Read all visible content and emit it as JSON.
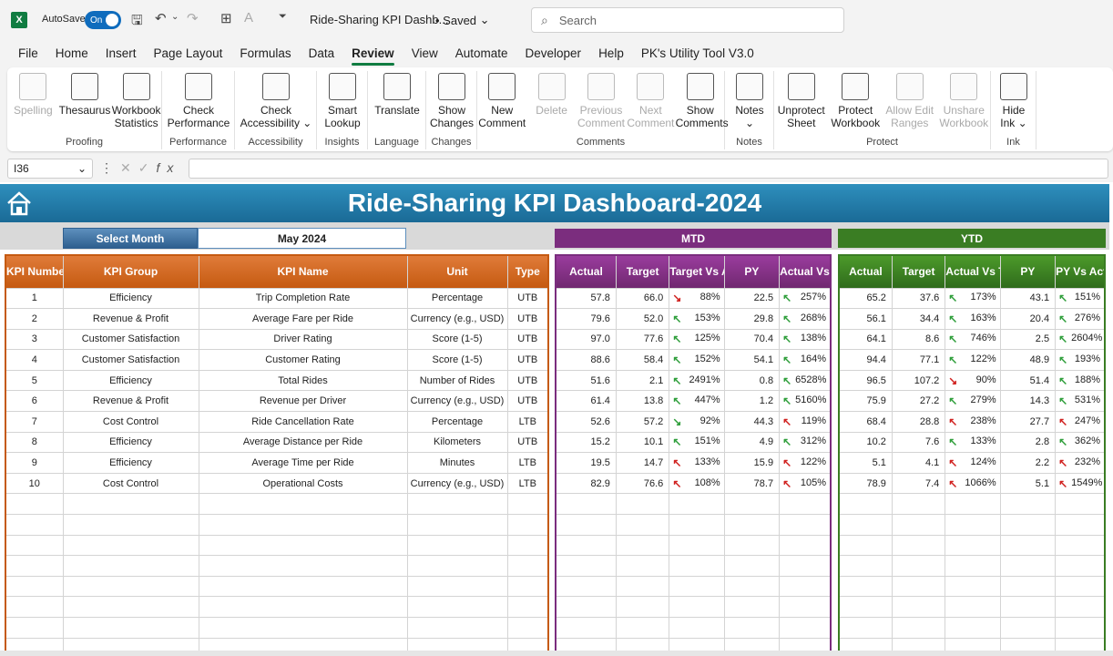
{
  "titlebar": {
    "logo": "X",
    "autosave_label": "AutoSave",
    "autosave_state": "On",
    "doc_title": "Ride-Sharing KPI Dashb...",
    "saved": "• Saved",
    "search_placeholder": "Search"
  },
  "menu": [
    "File",
    "Home",
    "Insert",
    "Page Layout",
    "Formulas",
    "Data",
    "Review",
    "View",
    "Automate",
    "Developer",
    "Help",
    "PK's Utility Tool V3.0"
  ],
  "active_menu": "Review",
  "ribbon": {
    "groups": [
      {
        "label": "Proofing",
        "buttons": [
          {
            "l1": "Spelling",
            "l2": "",
            "disabled": true,
            "icon": "abc-check-icon"
          },
          {
            "l1": "Thesaurus",
            "l2": "",
            "icon": "book-icon"
          },
          {
            "l1": "Workbook",
            "l2": "Statistics",
            "icon": "statistics-icon"
          }
        ]
      },
      {
        "label": "Performance",
        "buttons": [
          {
            "l1": "Check",
            "l2": "Performance",
            "icon": "performance-icon"
          }
        ]
      },
      {
        "label": "Accessibility",
        "buttons": [
          {
            "l1": "Check",
            "l2": "Accessibility ⌄",
            "icon": "accessibility-icon"
          }
        ]
      },
      {
        "label": "Insights",
        "buttons": [
          {
            "l1": "Smart",
            "l2": "Lookup",
            "icon": "lookup-icon"
          }
        ]
      },
      {
        "label": "Language",
        "buttons": [
          {
            "l1": "Translate",
            "l2": "",
            "icon": "translate-icon"
          }
        ]
      },
      {
        "label": "Changes",
        "buttons": [
          {
            "l1": "Show",
            "l2": "Changes",
            "icon": "changes-icon"
          }
        ]
      },
      {
        "label": "Comments",
        "buttons": [
          {
            "l1": "New",
            "l2": "Comment",
            "icon": "new-comment-icon"
          },
          {
            "l1": "Delete",
            "l2": "",
            "disabled": true,
            "icon": "delete-comment-icon"
          },
          {
            "l1": "Previous",
            "l2": "Comment",
            "disabled": true,
            "icon": "previous-comment-icon"
          },
          {
            "l1": "Next",
            "l2": "Comment",
            "disabled": true,
            "icon": "next-comment-icon"
          },
          {
            "l1": "Show",
            "l2": "Comments",
            "icon": "show-comments-icon"
          }
        ]
      },
      {
        "label": "Notes",
        "buttons": [
          {
            "l1": "Notes",
            "l2": "⌄",
            "icon": "notes-icon"
          }
        ]
      },
      {
        "label": "Protect",
        "buttons": [
          {
            "l1": "Unprotect",
            "l2": "Sheet",
            "icon": "unprotect-sheet-icon"
          },
          {
            "l1": "Protect",
            "l2": "Workbook",
            "icon": "protect-workbook-icon"
          },
          {
            "l1": "Allow Edit",
            "l2": "Ranges",
            "disabled": true,
            "icon": "allow-edit-icon"
          },
          {
            "l1": "Unshare",
            "l2": "Workbook",
            "disabled": true,
            "icon": "unshare-icon"
          }
        ]
      },
      {
        "label": "Ink",
        "buttons": [
          {
            "l1": "Hide",
            "l2": "Ink ⌄",
            "icon": "ink-icon"
          }
        ]
      }
    ]
  },
  "formula_bar": {
    "cell_ref": "I36",
    "fx": "fx"
  },
  "dashboard": {
    "title": "Ride-Sharing KPI Dashboard-2024",
    "select_month_label": "Select Month",
    "select_month_value": "May 2024",
    "mtd_label": "MTD",
    "ytd_label": "YTD",
    "kpi_headers": [
      "KPI Number",
      "KPI Group",
      "KPI Name",
      "Unit",
      "Type"
    ],
    "mtd_headers": [
      "Actual",
      "Target",
      "Target Vs Actual",
      "PY",
      "Actual Vs PY"
    ],
    "ytd_headers": [
      "Actual",
      "Target",
      "Actual Vs Target",
      "PY",
      "PY Vs Actual"
    ],
    "rows": [
      {
        "n": "1",
        "group": "Efficiency",
        "name": "Trip Completion Rate",
        "unit": "Percentage",
        "type": "UTB",
        "m_act": "57.8",
        "m_tgt": "66.0",
        "m_tva": "88%",
        "m_tva_dir": "down",
        "m_py": "22.5",
        "m_avp": "257%",
        "m_avp_dir": "up",
        "y_act": "65.2",
        "y_tgt": "37.6",
        "y_avt": "173%",
        "y_avt_dir": "up",
        "y_py": "43.1",
        "y_pva": "151%",
        "y_pva_dir": "up"
      },
      {
        "n": "2",
        "group": "Revenue & Profit",
        "name": "Average Fare per Ride",
        "unit": "Currency (e.g., USD)",
        "type": "UTB",
        "m_act": "79.6",
        "m_tgt": "52.0",
        "m_tva": "153%",
        "m_tva_dir": "up",
        "m_py": "29.8",
        "m_avp": "268%",
        "m_avp_dir": "up",
        "y_act": "56.1",
        "y_tgt": "34.4",
        "y_avt": "163%",
        "y_avt_dir": "up",
        "y_py": "20.4",
        "y_pva": "276%",
        "y_pva_dir": "up"
      },
      {
        "n": "3",
        "group": "Customer Satisfaction",
        "name": "Driver Rating",
        "unit": "Score (1-5)",
        "type": "UTB",
        "m_act": "97.0",
        "m_tgt": "77.6",
        "m_tva": "125%",
        "m_tva_dir": "up",
        "m_py": "70.4",
        "m_avp": "138%",
        "m_avp_dir": "up",
        "y_act": "64.1",
        "y_tgt": "8.6",
        "y_avt": "746%",
        "y_avt_dir": "up",
        "y_py": "2.5",
        "y_pva": "2604%",
        "y_pva_dir": "up"
      },
      {
        "n": "4",
        "group": "Customer Satisfaction",
        "name": "Customer Rating",
        "unit": "Score (1-5)",
        "type": "UTB",
        "m_act": "88.6",
        "m_tgt": "58.4",
        "m_tva": "152%",
        "m_tva_dir": "up",
        "m_py": "54.1",
        "m_avp": "164%",
        "m_avp_dir": "up",
        "y_act": "94.4",
        "y_tgt": "77.1",
        "y_avt": "122%",
        "y_avt_dir": "up",
        "y_py": "48.9",
        "y_pva": "193%",
        "y_pva_dir": "up"
      },
      {
        "n": "5",
        "group": "Efficiency",
        "name": "Total Rides",
        "unit": "Number of Rides",
        "type": "UTB",
        "m_act": "51.6",
        "m_tgt": "2.1",
        "m_tva": "2491%",
        "m_tva_dir": "up",
        "m_py": "0.8",
        "m_avp": "6528%",
        "m_avp_dir": "up",
        "y_act": "96.5",
        "y_tgt": "107.2",
        "y_avt": "90%",
        "y_avt_dir": "down",
        "y_py": "51.4",
        "y_pva": "188%",
        "y_pva_dir": "up"
      },
      {
        "n": "6",
        "group": "Revenue & Profit",
        "name": "Revenue per Driver",
        "unit": "Currency (e.g., USD)",
        "type": "UTB",
        "m_act": "61.4",
        "m_tgt": "13.8",
        "m_tva": "447%",
        "m_tva_dir": "up",
        "m_py": "1.2",
        "m_avp": "5160%",
        "m_avp_dir": "up",
        "y_act": "75.9",
        "y_tgt": "27.2",
        "y_avt": "279%",
        "y_avt_dir": "up",
        "y_py": "14.3",
        "y_pva": "531%",
        "y_pva_dir": "up"
      },
      {
        "n": "7",
        "group": "Cost Control",
        "name": "Ride Cancellation Rate",
        "unit": "Percentage",
        "type": "LTB",
        "m_act": "52.6",
        "m_tgt": "57.2",
        "m_tva": "92%",
        "m_tva_dir": "up-good",
        "m_py": "44.3",
        "m_avp": "119%",
        "m_avp_dir": "bad",
        "y_act": "68.4",
        "y_tgt": "28.8",
        "y_avt": "238%",
        "y_avt_dir": "bad",
        "y_py": "27.7",
        "y_pva": "247%",
        "y_pva_dir": "bad"
      },
      {
        "n": "8",
        "group": "Efficiency",
        "name": "Average Distance per Ride",
        "unit": "Kilometers",
        "type": "UTB",
        "m_act": "15.2",
        "m_tgt": "10.1",
        "m_tva": "151%",
        "m_tva_dir": "up",
        "m_py": "4.9",
        "m_avp": "312%",
        "m_avp_dir": "up",
        "y_act": "10.2",
        "y_tgt": "7.6",
        "y_avt": "133%",
        "y_avt_dir": "up",
        "y_py": "2.8",
        "y_pva": "362%",
        "y_pva_dir": "up"
      },
      {
        "n": "9",
        "group": "Efficiency",
        "name": "Average Time per Ride",
        "unit": "Minutes",
        "type": "LTB",
        "m_act": "19.5",
        "m_tgt": "14.7",
        "m_tva": "133%",
        "m_tva_dir": "bad",
        "m_py": "15.9",
        "m_avp": "122%",
        "m_avp_dir": "bad",
        "y_act": "5.1",
        "y_tgt": "4.1",
        "y_avt": "124%",
        "y_avt_dir": "bad",
        "y_py": "2.2",
        "y_pva": "232%",
        "y_pva_dir": "bad"
      },
      {
        "n": "10",
        "group": "Cost Control",
        "name": "Operational Costs",
        "unit": "Currency (e.g., USD)",
        "type": "LTB",
        "m_act": "82.9",
        "m_tgt": "76.6",
        "m_tva": "108%",
        "m_tva_dir": "bad",
        "m_py": "78.7",
        "m_avp": "105%",
        "m_avp_dir": "bad",
        "y_act": "78.9",
        "y_tgt": "7.4",
        "y_avt": "1066%",
        "y_avt_dir": "bad",
        "y_py": "5.1",
        "y_pva": "1549%",
        "y_pva_dir": "bad"
      }
    ],
    "empty_rows": 8
  }
}
